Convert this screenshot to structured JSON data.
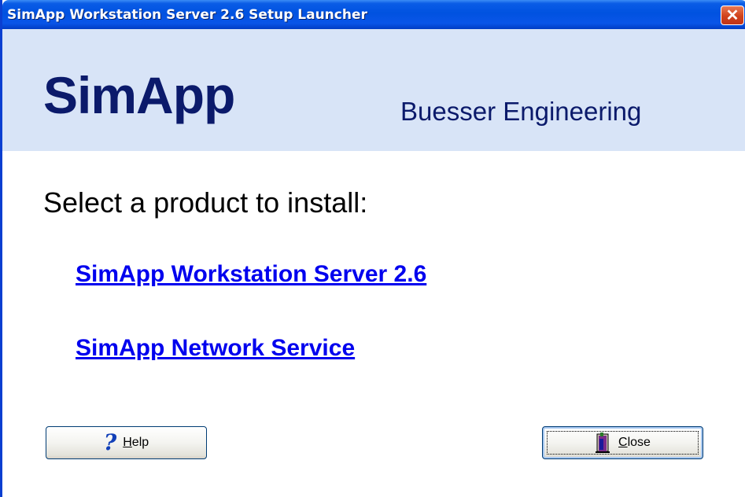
{
  "window": {
    "title": "SimApp Workstation Server 2.6 Setup Launcher",
    "close_glyph": "✕"
  },
  "banner": {
    "brand": "SimApp",
    "company": "Buesser Engineering"
  },
  "main": {
    "prompt": "Select a product to install:",
    "products": [
      {
        "label": "SimApp Workstation Server 2.6"
      },
      {
        "label": "SimApp Network Service"
      }
    ]
  },
  "buttons": {
    "help": {
      "label": "Help",
      "mnemonic": "H",
      "rest": "elp",
      "icon": "question-mark-icon"
    },
    "close": {
      "label": "Close",
      "mnemonic": "C",
      "rest": "lose",
      "icon": "exit-door-icon"
    }
  },
  "colors": {
    "title_bar": "#0052e0",
    "banner_bg": "#d8e4f7",
    "brand_text": "#0b1a6b",
    "link": "#0000ee"
  }
}
